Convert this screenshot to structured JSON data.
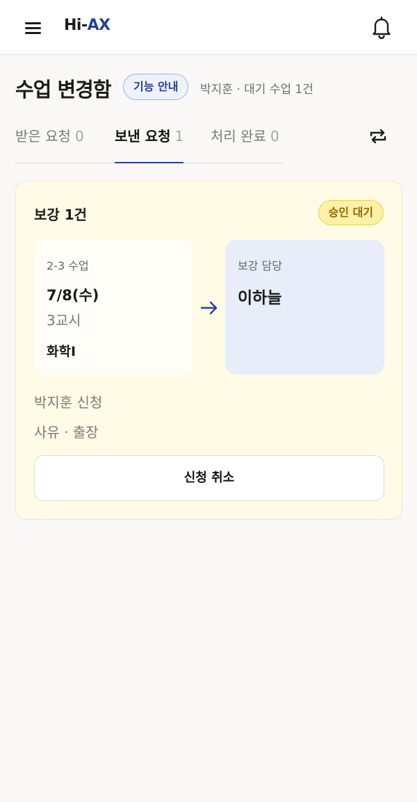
{
  "header": {
    "logo_prefix": "Hi-",
    "logo_suffix": "AX",
    "menu_icon": "hamburger-menu-icon",
    "bell_icon": "bell-icon"
  },
  "page": {
    "title": "수업 변경함",
    "guide_label": "기능 안내",
    "meta": "박지훈 · 대기 수업 1건"
  },
  "tabs": [
    {
      "label": "받은 요청",
      "count": "0",
      "active": false
    },
    {
      "label": "보낸 요청",
      "count": "1",
      "active": true
    },
    {
      "label": "처리 완료",
      "count": "0",
      "active": false
    }
  ],
  "refresh_icon": "swap-refresh-icon",
  "request_card": {
    "title": "보강 1건",
    "status": "승인 대기",
    "from": {
      "label": "2-3 수업",
      "date": "7/8(수)",
      "period": "3교시",
      "subject": "화학I"
    },
    "arrow_icon": "arrow-right-icon",
    "to": {
      "label": "보강 담당",
      "name": "이하늘"
    },
    "applicant": "박지훈 신청",
    "reason": "사유 · 출장",
    "cancel_label": "신청 취소"
  },
  "colors": {
    "accent": "#24409a",
    "card_bg": "#fffbe6",
    "badge_bg": "#fdf1a8",
    "badge_text": "#8d6a00",
    "target_box_bg": "#e8edfa"
  }
}
